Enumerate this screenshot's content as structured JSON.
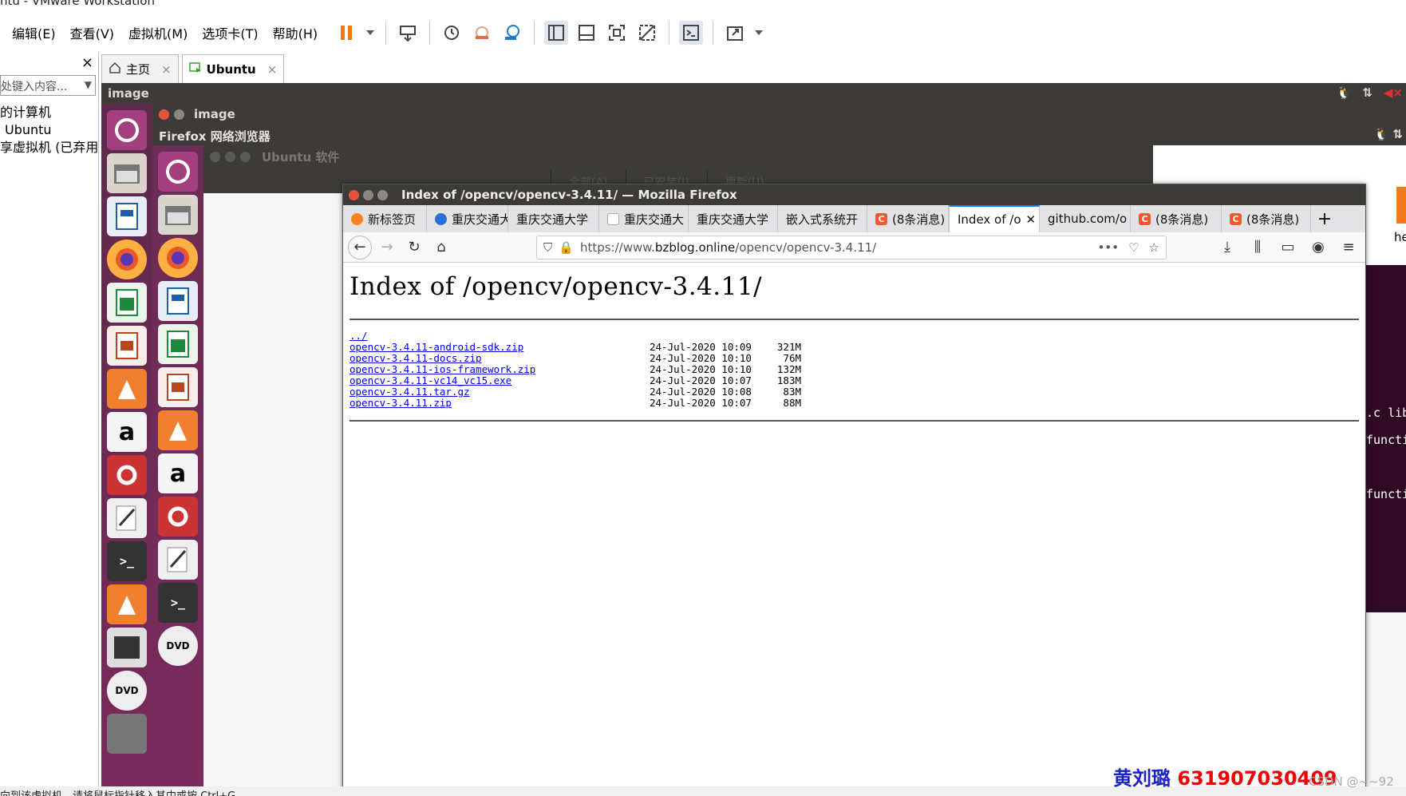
{
  "vmware": {
    "title": "ntu - VMware Workstation",
    "menus": [
      "编辑(E)",
      "查看(V)",
      "虚拟机(M)",
      "选项卡(T)",
      "帮助(H)"
    ],
    "library": {
      "close": "×",
      "search_placeholder": "处键入内容...",
      "tree": [
        "的计算机",
        "Ubuntu",
        "享虚拟机 (已弃用)"
      ]
    },
    "tabs": [
      {
        "label": "主页",
        "close": "×"
      },
      {
        "label": "Ubuntu",
        "close": "×"
      }
    ],
    "statusbar": "向到该虚拟机，请将鼠标指针移入其中或按 Ctrl+G。"
  },
  "ubuntu": {
    "outer_title": "image",
    "inner_title": "image",
    "inner_panel": "Firefox 网络浏览器",
    "software_title": "Ubuntu 软件",
    "software_tabs": [
      "全部(A)",
      "已安装(I)",
      "更新(U)"
    ],
    "terminal_lines": [
      ".c lib",
      "functi",
      "functi"
    ],
    "terminal_top_text": "he"
  },
  "firefox": {
    "window_title": "Index of /opencv/opencv-3.4.11/ — Mozilla Firefox",
    "tabs": [
      {
        "label": "新标签页",
        "icon": "firefox"
      },
      {
        "label": "重庆交通大",
        "icon": "globe"
      },
      {
        "label": "重庆交通大学",
        "icon": "none"
      },
      {
        "label": "重庆交通大",
        "icon": "white"
      },
      {
        "label": "重庆交通大学",
        "icon": "none"
      },
      {
        "label": "嵌入式系统开",
        "icon": "none"
      },
      {
        "label": "(8条消息)",
        "icon": "csdn"
      },
      {
        "label": "Index of /o",
        "icon": "none",
        "active": true
      },
      {
        "label": "github.com/o",
        "icon": "none"
      },
      {
        "label": "(8条消息)",
        "icon": "csdn"
      },
      {
        "label": "(8条消息)",
        "icon": "csdn"
      }
    ],
    "url_prefix": "https://www.",
    "url_host": "bzblog.online",
    "url_path": "/opencv/opencv-3.4.11/",
    "page_heading": "Index of /opencv/opencv-3.4.11/",
    "parent_link": "../",
    "files": [
      {
        "name": "opencv-3.4.11-android-sdk.zip",
        "date": "24-Jul-2020 10:09",
        "size": "321M"
      },
      {
        "name": "opencv-3.4.11-docs.zip",
        "date": "24-Jul-2020 10:10",
        "size": "76M"
      },
      {
        "name": "opencv-3.4.11-ios-framework.zip",
        "date": "24-Jul-2020 10:10",
        "size": "132M"
      },
      {
        "name": "opencv-3.4.11-vc14_vc15.exe",
        "date": "24-Jul-2020 10:07",
        "size": "183M"
      },
      {
        "name": "opencv-3.4.11.tar.gz",
        "date": "24-Jul-2020 10:08",
        "size": "83M"
      },
      {
        "name": "opencv-3.4.11.zip",
        "date": "24-Jul-2020 10:07",
        "size": "88M"
      }
    ]
  },
  "watermark": {
    "name": "黄刘璐",
    "number": "631907030409",
    "csdn": "CSDN @~~92"
  },
  "colors": {
    "launcher": "#77216f",
    "ubuntu_panel": "#3c3b37",
    "link": "#0000ee",
    "accent": "#0a84ff"
  }
}
